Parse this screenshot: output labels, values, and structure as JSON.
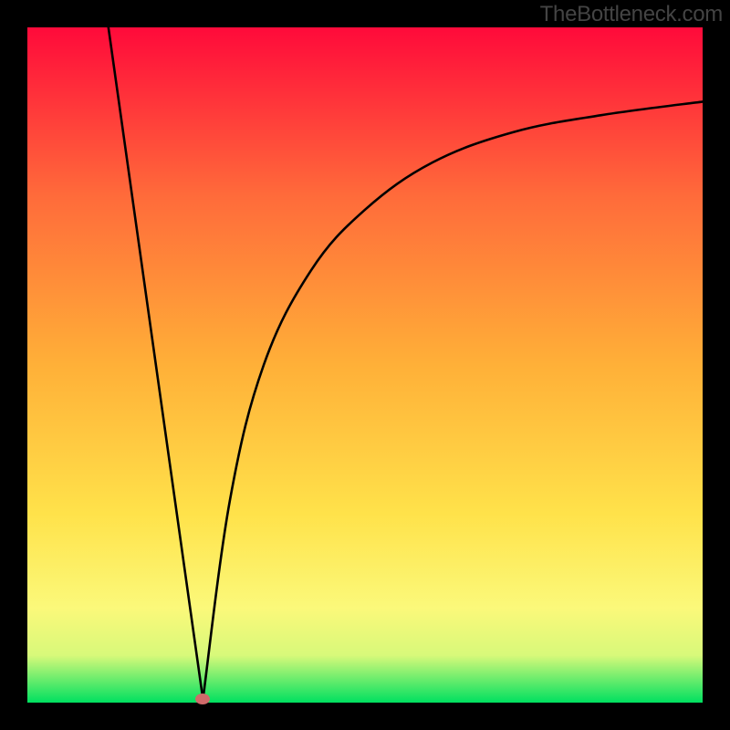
{
  "watermark": "TheBottleneck.com",
  "colors": {
    "top": "#ff0a3a",
    "mid1": "#ff6b3a",
    "mid2": "#ffb038",
    "mid3": "#ffe24a",
    "band_yellow": "#fbf97a",
    "band_light": "#d8f97a",
    "bottom": "#00e060",
    "curve": "#000000",
    "marker": "#d06a6a",
    "frame": "#000000"
  },
  "chart_data": {
    "type": "line",
    "title": "",
    "xlabel": "",
    "ylabel": "",
    "x_range": [
      0,
      100
    ],
    "y_range": [
      0,
      100
    ],
    "minimum_marker": {
      "x": 26,
      "y": 0.5
    },
    "description": "Red-to-green vertical heat gradient with a black V-shaped curve whose minimum touches a small marker near the bottom.",
    "left_segment": {
      "comment": "nearly straight steep descent from top-left to the minimum",
      "points": [
        {
          "x": 12,
          "y": 100
        },
        {
          "x": 26,
          "y": 0.5
        }
      ]
    },
    "right_segment": {
      "comment": "sharp rise then decelerating approach toward ~88 on the right edge",
      "points": [
        {
          "x": 26,
          "y": 0.5
        },
        {
          "x": 30,
          "y": 30
        },
        {
          "x": 35,
          "y": 50
        },
        {
          "x": 42,
          "y": 64
        },
        {
          "x": 50,
          "y": 73
        },
        {
          "x": 60,
          "y": 80
        },
        {
          "x": 72,
          "y": 84.5
        },
        {
          "x": 85,
          "y": 87
        },
        {
          "x": 100,
          "y": 89
        }
      ]
    },
    "gradient_stops": [
      {
        "pos": 0.0,
        "color_key": "top"
      },
      {
        "pos": 0.25,
        "color_key": "mid1"
      },
      {
        "pos": 0.5,
        "color_key": "mid2"
      },
      {
        "pos": 0.72,
        "color_key": "mid3"
      },
      {
        "pos": 0.86,
        "color_key": "band_yellow"
      },
      {
        "pos": 0.93,
        "color_key": "band_light"
      },
      {
        "pos": 1.0,
        "color_key": "bottom"
      }
    ]
  }
}
